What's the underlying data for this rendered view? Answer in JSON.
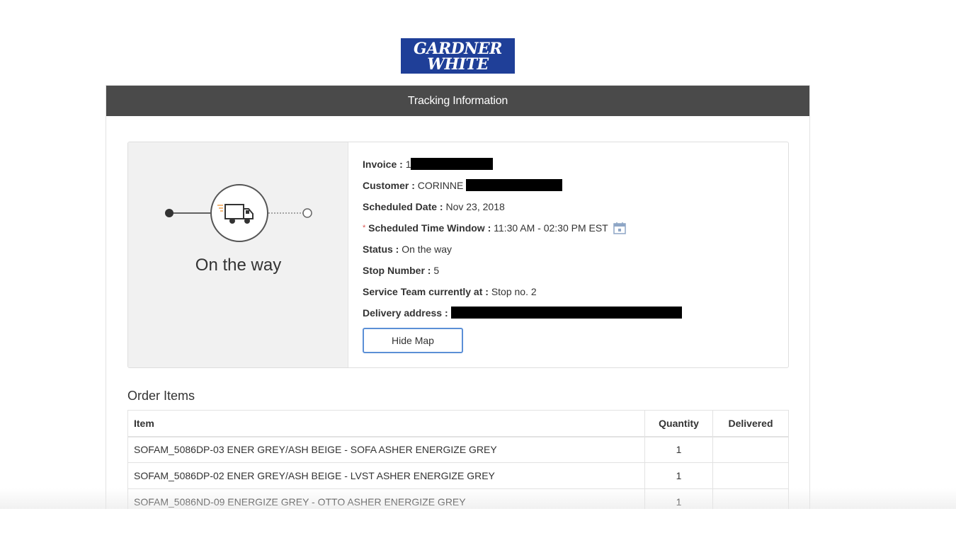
{
  "brand": {
    "logo_line1": "GARDNER",
    "logo_line2": "WHITE",
    "color": "#1f3f98"
  },
  "header": {
    "title": "Tracking Information"
  },
  "status": {
    "title": "On the way",
    "icon": "delivery-truck-icon"
  },
  "details": {
    "invoice_label": "Invoice :",
    "invoice_value": "1",
    "customer_label": "Customer :",
    "customer_value": "CORINNE",
    "scheduled_date_label": "Scheduled Date :",
    "scheduled_date_value": "Nov 23, 2018",
    "required_marker": "*",
    "time_window_label": "Scheduled Time Window :",
    "time_window_value": "11:30 AM - 02:30 PM EST",
    "status_label": "Status :",
    "status_value": "On the way",
    "stop_number_label": "Stop Number :",
    "stop_number_value": "5",
    "service_team_label": "Service Team currently at :",
    "service_team_value": "Stop no. 2",
    "delivery_address_label": "Delivery address :"
  },
  "actions": {
    "hide_map_label": "Hide Map"
  },
  "order": {
    "title": "Order Items",
    "columns": [
      "Item",
      "Quantity",
      "Delivered"
    ],
    "rows": [
      {
        "item": "SOFAM_5086DP-03 ENER GREY/ASH BEIGE - SOFA ASHER ENERGIZE GREY",
        "quantity": "1",
        "delivered": ""
      },
      {
        "item": "SOFAM_5086DP-02 ENER GREY/ASH BEIGE - LVST ASHER ENERGIZE GREY",
        "quantity": "1",
        "delivered": ""
      },
      {
        "item": "SOFAM_5086ND-09 ENERGIZE GREY - OTTO ASHER ENERGIZE GREY",
        "quantity": "1",
        "delivered": ""
      }
    ]
  },
  "colors": {
    "header_bg": "#4a4a4a",
    "accent_orange": "#f0a04b",
    "button_border": "#5b8fd6"
  }
}
